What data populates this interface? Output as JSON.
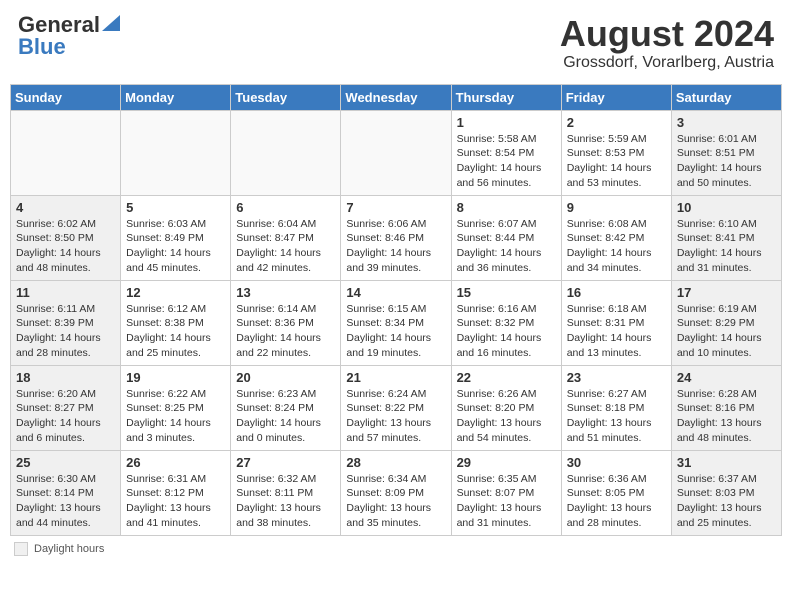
{
  "header": {
    "logo_general": "General",
    "logo_blue": "Blue",
    "month_title": "August 2024",
    "location": "Grossdorf, Vorarlberg, Austria"
  },
  "days_of_week": [
    "Sunday",
    "Monday",
    "Tuesday",
    "Wednesday",
    "Thursday",
    "Friday",
    "Saturday"
  ],
  "weeks": [
    [
      {
        "day": "",
        "info": "",
        "empty": true
      },
      {
        "day": "",
        "info": "",
        "empty": true
      },
      {
        "day": "",
        "info": "",
        "empty": true
      },
      {
        "day": "",
        "info": "",
        "empty": true
      },
      {
        "day": "1",
        "info": "Sunrise: 5:58 AM\nSunset: 8:54 PM\nDaylight: 14 hours\nand 56 minutes."
      },
      {
        "day": "2",
        "info": "Sunrise: 5:59 AM\nSunset: 8:53 PM\nDaylight: 14 hours\nand 53 minutes."
      },
      {
        "day": "3",
        "info": "Sunrise: 6:01 AM\nSunset: 8:51 PM\nDaylight: 14 hours\nand 50 minutes."
      }
    ],
    [
      {
        "day": "4",
        "info": "Sunrise: 6:02 AM\nSunset: 8:50 PM\nDaylight: 14 hours\nand 48 minutes."
      },
      {
        "day": "5",
        "info": "Sunrise: 6:03 AM\nSunset: 8:49 PM\nDaylight: 14 hours\nand 45 minutes."
      },
      {
        "day": "6",
        "info": "Sunrise: 6:04 AM\nSunset: 8:47 PM\nDaylight: 14 hours\nand 42 minutes."
      },
      {
        "day": "7",
        "info": "Sunrise: 6:06 AM\nSunset: 8:46 PM\nDaylight: 14 hours\nand 39 minutes."
      },
      {
        "day": "8",
        "info": "Sunrise: 6:07 AM\nSunset: 8:44 PM\nDaylight: 14 hours\nand 36 minutes."
      },
      {
        "day": "9",
        "info": "Sunrise: 6:08 AM\nSunset: 8:42 PM\nDaylight: 14 hours\nand 34 minutes."
      },
      {
        "day": "10",
        "info": "Sunrise: 6:10 AM\nSunset: 8:41 PM\nDaylight: 14 hours\nand 31 minutes."
      }
    ],
    [
      {
        "day": "11",
        "info": "Sunrise: 6:11 AM\nSunset: 8:39 PM\nDaylight: 14 hours\nand 28 minutes."
      },
      {
        "day": "12",
        "info": "Sunrise: 6:12 AM\nSunset: 8:38 PM\nDaylight: 14 hours\nand 25 minutes."
      },
      {
        "day": "13",
        "info": "Sunrise: 6:14 AM\nSunset: 8:36 PM\nDaylight: 14 hours\nand 22 minutes."
      },
      {
        "day": "14",
        "info": "Sunrise: 6:15 AM\nSunset: 8:34 PM\nDaylight: 14 hours\nand 19 minutes."
      },
      {
        "day": "15",
        "info": "Sunrise: 6:16 AM\nSunset: 8:32 PM\nDaylight: 14 hours\nand 16 minutes."
      },
      {
        "day": "16",
        "info": "Sunrise: 6:18 AM\nSunset: 8:31 PM\nDaylight: 14 hours\nand 13 minutes."
      },
      {
        "day": "17",
        "info": "Sunrise: 6:19 AM\nSunset: 8:29 PM\nDaylight: 14 hours\nand 10 minutes."
      }
    ],
    [
      {
        "day": "18",
        "info": "Sunrise: 6:20 AM\nSunset: 8:27 PM\nDaylight: 14 hours\nand 6 minutes."
      },
      {
        "day": "19",
        "info": "Sunrise: 6:22 AM\nSunset: 8:25 PM\nDaylight: 14 hours\nand 3 minutes."
      },
      {
        "day": "20",
        "info": "Sunrise: 6:23 AM\nSunset: 8:24 PM\nDaylight: 14 hours\nand 0 minutes."
      },
      {
        "day": "21",
        "info": "Sunrise: 6:24 AM\nSunset: 8:22 PM\nDaylight: 13 hours\nand 57 minutes."
      },
      {
        "day": "22",
        "info": "Sunrise: 6:26 AM\nSunset: 8:20 PM\nDaylight: 13 hours\nand 54 minutes."
      },
      {
        "day": "23",
        "info": "Sunrise: 6:27 AM\nSunset: 8:18 PM\nDaylight: 13 hours\nand 51 minutes."
      },
      {
        "day": "24",
        "info": "Sunrise: 6:28 AM\nSunset: 8:16 PM\nDaylight: 13 hours\nand 48 minutes."
      }
    ],
    [
      {
        "day": "25",
        "info": "Sunrise: 6:30 AM\nSunset: 8:14 PM\nDaylight: 13 hours\nand 44 minutes."
      },
      {
        "day": "26",
        "info": "Sunrise: 6:31 AM\nSunset: 8:12 PM\nDaylight: 13 hours\nand 41 minutes."
      },
      {
        "day": "27",
        "info": "Sunrise: 6:32 AM\nSunset: 8:11 PM\nDaylight: 13 hours\nand 38 minutes."
      },
      {
        "day": "28",
        "info": "Sunrise: 6:34 AM\nSunset: 8:09 PM\nDaylight: 13 hours\nand 35 minutes."
      },
      {
        "day": "29",
        "info": "Sunrise: 6:35 AM\nSunset: 8:07 PM\nDaylight: 13 hours\nand 31 minutes."
      },
      {
        "day": "30",
        "info": "Sunrise: 6:36 AM\nSunset: 8:05 PM\nDaylight: 13 hours\nand 28 minutes."
      },
      {
        "day": "31",
        "info": "Sunrise: 6:37 AM\nSunset: 8:03 PM\nDaylight: 13 hours\nand 25 minutes."
      }
    ]
  ],
  "footer": {
    "shaded_label": "Daylight hours"
  }
}
